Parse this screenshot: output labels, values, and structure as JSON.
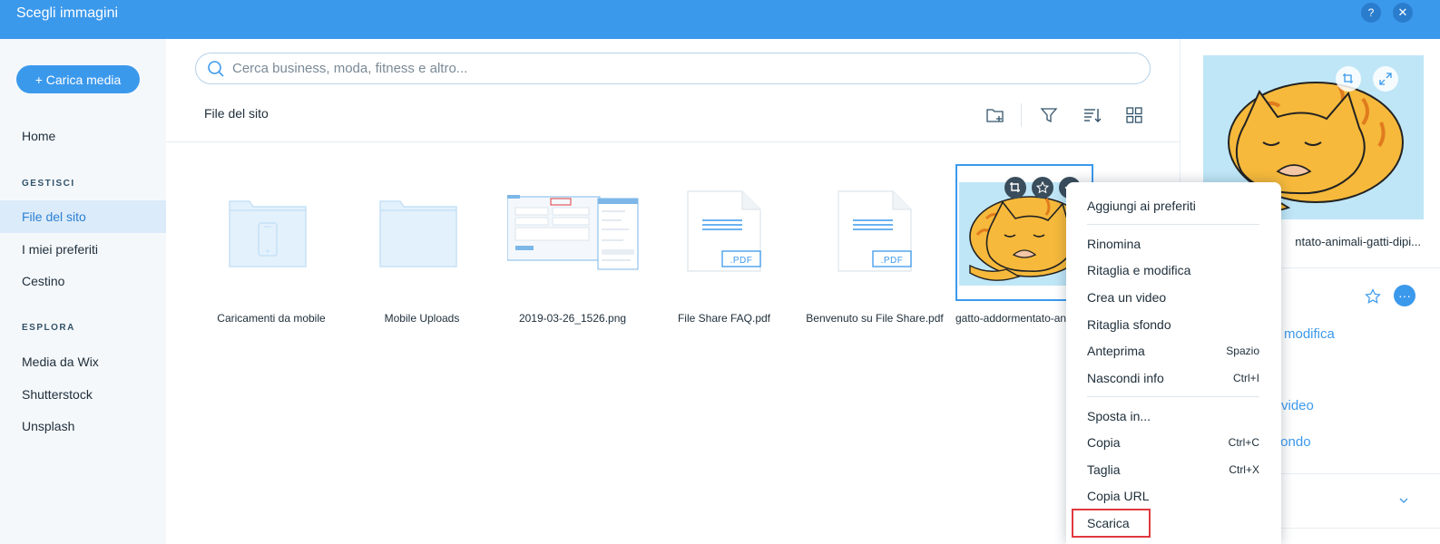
{
  "header": {
    "title": "Scegli immagini",
    "help_label": "?",
    "close_label": "✕",
    "color": "#3b99ec"
  },
  "sidebar": {
    "upload_label": "+ Carica media",
    "home": "Home",
    "manage_heading": "GESTISCI",
    "manage_items": [
      "File del sito",
      "I miei preferiti",
      "Cestino"
    ],
    "explore_heading": "ESPLORA",
    "explore_items": [
      "Media da Wix",
      "Shutterstock",
      "Unsplash"
    ],
    "active_item": "File del sito"
  },
  "main": {
    "search_placeholder": "Cerca business, moda, fitness e altro...",
    "breadcrumb": "File del sito",
    "toolbar_icons": [
      "new-folder-icon",
      "filter-icon",
      "sort-icon",
      "grid-view-icon"
    ],
    "items": [
      {
        "caption": "Caricamenti da mobile",
        "kind": "folder-mobile"
      },
      {
        "caption": "Mobile Uploads",
        "kind": "folder"
      },
      {
        "caption": "2019-03-26_1526.png",
        "kind": "screenshot"
      },
      {
        "caption": "File Share FAQ.pdf",
        "kind": "pdf"
      },
      {
        "caption": "Benvenuto su File Share.pdf",
        "kind": "pdf"
      },
      {
        "caption": "gatto-addormentato-an",
        "kind": "image"
      }
    ],
    "pdf_badge": ".PDF"
  },
  "context_menu": {
    "items": [
      {
        "label": "Aggiungi ai preferiti",
        "shortcut": ""
      },
      {
        "label": "Rinomina",
        "shortcut": ""
      },
      {
        "label": "Ritaglia e modifica",
        "shortcut": ""
      },
      {
        "label": "Crea un video",
        "shortcut": ""
      },
      {
        "label": "Ritaglia sfondo",
        "shortcut": ""
      },
      {
        "label": "Anteprima",
        "shortcut": "Spazio"
      },
      {
        "label": "Nascondi info",
        "shortcut": "Ctrl+I"
      },
      {
        "label": "Sposta in...",
        "shortcut": ""
      },
      {
        "label": "Copia",
        "shortcut": "Ctrl+C"
      },
      {
        "label": "Taglia",
        "shortcut": "Ctrl+X"
      },
      {
        "label": "Copia URL",
        "shortcut": ""
      },
      {
        "label": "Scarica",
        "shortcut": ""
      }
    ],
    "highlighted": "Scarica",
    "highlight_color": "#e0393e"
  },
  "right_panel": {
    "file_name": "ntato-animali-gatti-dipi...",
    "links": [
      "modifica",
      "video",
      "fondo"
    ]
  }
}
